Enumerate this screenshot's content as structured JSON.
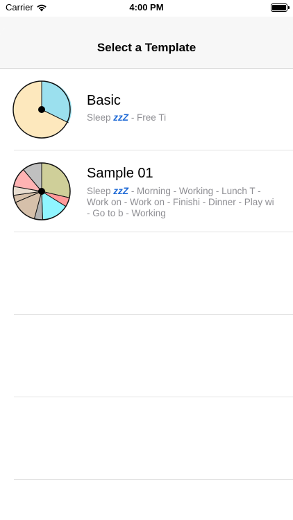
{
  "status_bar": {
    "carrier": "Carrier",
    "time": "4:00 PM"
  },
  "sheet": {
    "title": "Select a Template"
  },
  "templates": [
    {
      "name": "Basic",
      "desc_before": "Sleep",
      "zzz": "zzZ",
      "desc_after": "- Free Ti",
      "pie_colors": [
        "#9be0ee",
        "#fde8bd"
      ]
    },
    {
      "name": "Sample 01",
      "desc_before": "Sleep",
      "zzz": "zzZ",
      "desc_after": "- Morning - Working - Lunch T - Work on - Work on - Finishi - Dinner  - Play wi - Go to b - Working",
      "pie_colors": [
        "#cfcf99",
        "#ff9a9a",
        "#8ff5ff",
        "#b3b3b3",
        "#d6c0aa",
        "#d6c0aa",
        "#e8ddd0",
        "#ffb3b3",
        "#c0c0c0"
      ]
    }
  ]
}
